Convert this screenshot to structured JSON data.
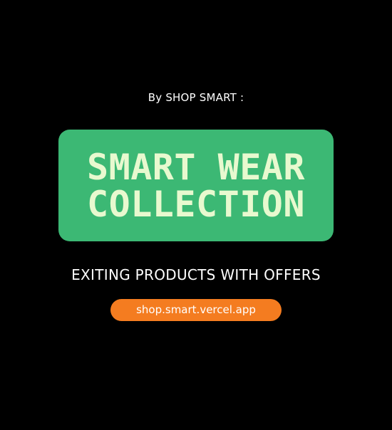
{
  "byline": "By SHOP SMART :",
  "hero": {
    "line1": "SMART WEAR",
    "line2": "COLLECTION"
  },
  "tagline": "EXITING PRODUCTS WITH OFFERS",
  "url": "shop.smart.vercel.app",
  "colors": {
    "background": "#000000",
    "card": "#3cb874",
    "card_text": "#e8f9cf",
    "pill": "#f47c20",
    "text": "#ffffff"
  }
}
